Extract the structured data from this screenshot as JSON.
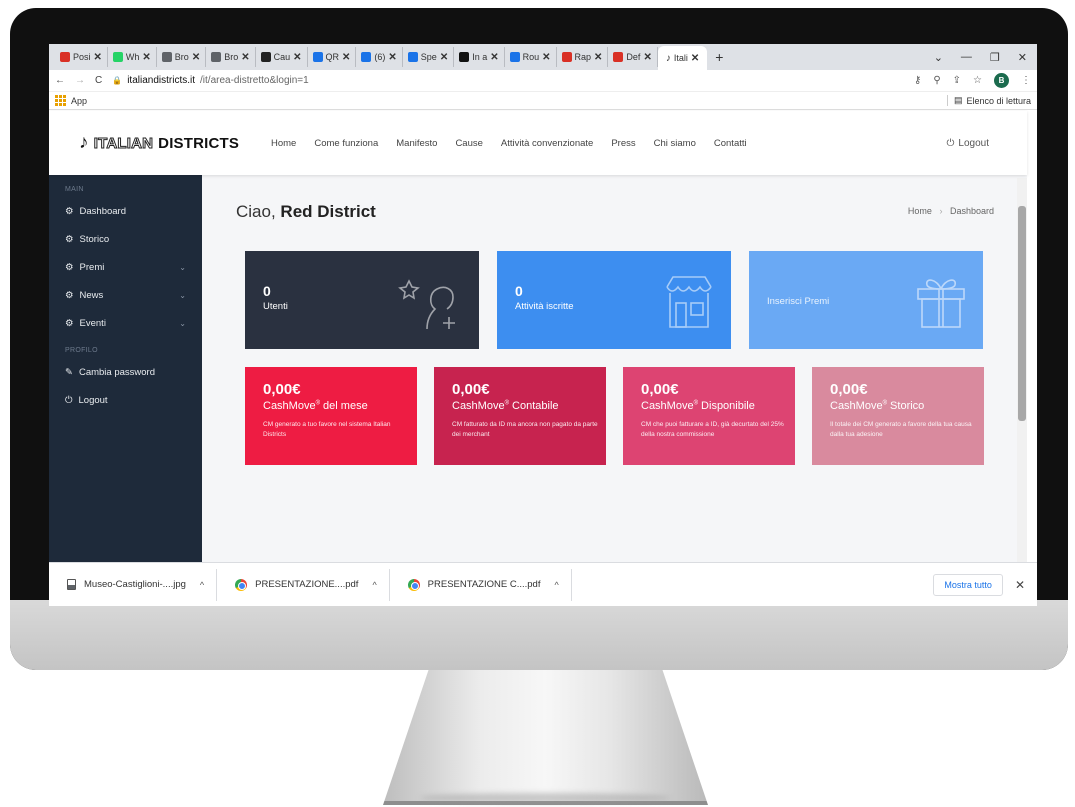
{
  "browser": {
    "tabs": [
      {
        "label": "Posi",
        "color": "#d93025"
      },
      {
        "label": "Wh",
        "color": "#25d366"
      },
      {
        "label": "Bro",
        "color": "#5f6368"
      },
      {
        "label": "Bro",
        "color": "#5f6368"
      },
      {
        "label": "Cau",
        "color": "#222222"
      },
      {
        "label": "QR",
        "color": "#1a73e8"
      },
      {
        "label": "(6)",
        "color": "#1a73e8"
      },
      {
        "label": "Spe",
        "color": "#1a73e8"
      },
      {
        "label": "In a",
        "color": "#111111"
      },
      {
        "label": "Rou",
        "color": "#1a73e8"
      },
      {
        "label": "Rap",
        "color": "#d93025"
      },
      {
        "label": "Def",
        "color": "#d93025"
      }
    ],
    "active_tab": "Itali",
    "url_host": "italiandistricts.it",
    "url_path": "/it/area-distretto&login=1",
    "profile_initial": "B",
    "bookmarks_apps": "App",
    "reading_list": "Elenco di lettura"
  },
  "site": {
    "logo_first": "ITALIAN",
    "logo_second": "DISTRICTS",
    "nav": [
      "Home",
      "Come funziona",
      "Manifesto",
      "Cause",
      "Attività convenzionate",
      "Press",
      "Chi siamo",
      "Contatti"
    ],
    "logout": "Logout"
  },
  "sidebar": {
    "section_main": "MAIN",
    "items": [
      {
        "label": "Dashboard",
        "chevron": false
      },
      {
        "label": "Storico",
        "chevron": false
      },
      {
        "label": "Premi",
        "chevron": true
      },
      {
        "label": "News",
        "chevron": true
      },
      {
        "label": "Eventi",
        "chevron": true
      }
    ],
    "section_profile": "PROFILO",
    "change_password": "Cambia password",
    "logout": "Logout"
  },
  "main": {
    "greeting": "Ciao,",
    "user": "Red District",
    "breadcrumb_home": "Home",
    "breadcrumb_sep": "›",
    "breadcrumb_current": "Dashboard"
  },
  "stats": [
    {
      "value": "0",
      "label": "Utenti",
      "color": "#2a3140",
      "icon": "user-star-icon"
    },
    {
      "value": "0",
      "label": "Attività iscritte",
      "color": "#3d8ef0",
      "icon": "shop-icon"
    },
    {
      "value": "",
      "label": "Inserisci Premi",
      "color": "#6aa9f4",
      "icon": "gift-icon"
    }
  ],
  "money": [
    {
      "amount": "0,00€",
      "title_a": "CashMove",
      "reg": "®",
      "title_b": " del mese",
      "desc": "CM generato a tuo favore nel sistema Italian Districts",
      "color": "#ee1c43"
    },
    {
      "amount": "0,00€",
      "title_a": "CashMove",
      "reg": "®",
      "title_b": " Contabile",
      "desc": "CM fatturato da ID ma ancora non pagato da parte dei merchant",
      "color": "#c7234f"
    },
    {
      "amount": "0,00€",
      "title_a": "CashMove",
      "reg": "®",
      "title_b": " Disponibile",
      "desc": "CM che puoi fatturare a ID, già decurtato del 25% della nostra commissione",
      "color": "#dd4472"
    },
    {
      "amount": "0,00€",
      "title_a": "CashMove",
      "reg": "®",
      "title_b": " Storico",
      "desc": "Il totale dei CM generato a favore della tua causa dalla tua adesione",
      "color": "#d98a9e"
    }
  ],
  "downloads": {
    "items": [
      "Museo-Castiglioni-....jpg",
      "PRESENTAZIONE....pdf",
      "PRESENTAZIONE C....pdf"
    ],
    "show_all": "Mostra tutto"
  }
}
